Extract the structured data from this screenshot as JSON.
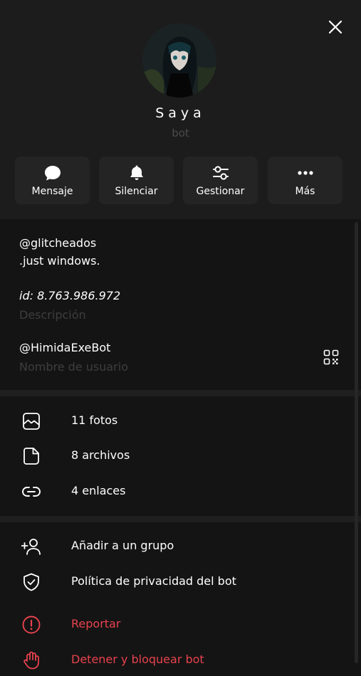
{
  "profile": {
    "name": "Saya",
    "subtitle": "bot"
  },
  "actions": [
    {
      "label": "Mensaje",
      "icon": "chat-bubble-icon"
    },
    {
      "label": "Silenciar",
      "icon": "bell-icon"
    },
    {
      "label": "Gestionar",
      "icon": "sliders-icon"
    },
    {
      "label": "Más",
      "icon": "more-dots-icon"
    }
  ],
  "info": {
    "bio_line1": "@glitcheados",
    "bio_line2": ".just windows.",
    "bio_id": "id: 8.763.986.972",
    "bio_caption": "Descripción",
    "username": "@HimidaExeBot",
    "username_caption": "Nombre de usuario"
  },
  "media": [
    {
      "label": "11 fotos",
      "icon": "photo-icon"
    },
    {
      "label": "8 archivos",
      "icon": "file-icon"
    },
    {
      "label": "4 enlaces",
      "icon": "link-icon"
    }
  ],
  "bot_actions": [
    {
      "label": "Añadir a un grupo",
      "icon": "add-user-icon"
    },
    {
      "label": "Política de privacidad del bot",
      "icon": "shield-icon"
    },
    {
      "label": "Reportar",
      "icon": "report-icon",
      "danger": true
    },
    {
      "label": "Detener y bloquear bot",
      "icon": "hand-stop-icon",
      "danger": true
    }
  ],
  "colors": {
    "background": "#1c1c1c",
    "section": "#141414",
    "danger": "#e8424e",
    "muted": "#3e3e3e"
  }
}
